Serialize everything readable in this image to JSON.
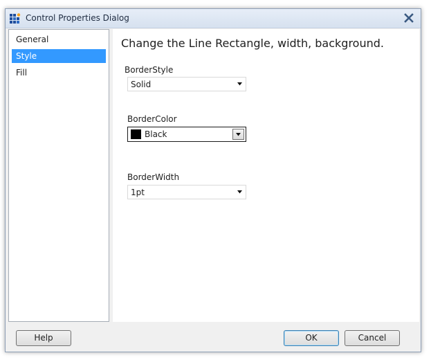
{
  "window": {
    "title": "Control Properties Dialog",
    "icons": {
      "app": "app-grid-icon",
      "close": "close-icon"
    }
  },
  "nav": {
    "items": [
      {
        "label": "General",
        "selected": false
      },
      {
        "label": "Style",
        "selected": true
      },
      {
        "label": "Fill",
        "selected": false
      }
    ]
  },
  "content": {
    "heading": "Change the Line Rectangle, width, background.",
    "border_style": {
      "label": "BorderStyle",
      "value": "Solid"
    },
    "border_color": {
      "label": "BorderColor",
      "value": "Black",
      "swatch": "#000000"
    },
    "border_width": {
      "label": "BorderWidth",
      "value": "1pt"
    }
  },
  "footer": {
    "help_label": "Help",
    "ok_label": "OK",
    "cancel_label": "Cancel"
  },
  "colors": {
    "selection": "#3399ff",
    "window_bg": "#f0f0f0"
  }
}
